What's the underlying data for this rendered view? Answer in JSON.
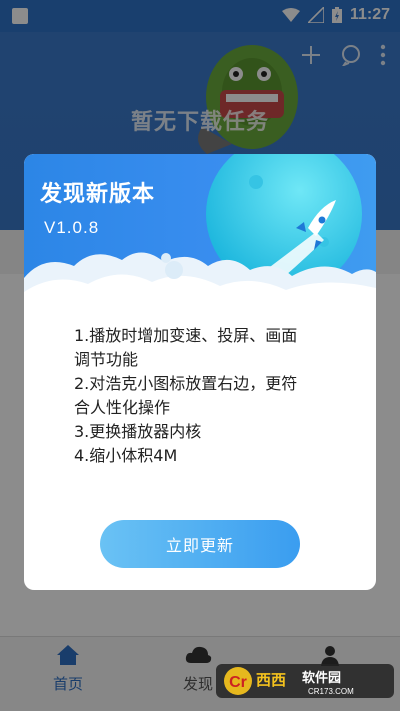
{
  "status_bar": {
    "time": "11:27"
  },
  "header": {
    "empty_text": "暂无下载任务"
  },
  "bottom_nav": {
    "items": [
      {
        "label": "首页"
      },
      {
        "label": "发现"
      }
    ]
  },
  "dialog": {
    "title": "发现新版本",
    "version": "V1.0.8",
    "notes": [
      "1.播放时增加变速、投屏、画面",
      "调节功能",
      "2.对浩克小图标放置右边，更符",
      "合人性化操作",
      "3.更换播放器内核",
      "4.缩小体积4M"
    ],
    "update_button": "立即更新"
  },
  "watermark": {
    "brand": "西西软件园",
    "site": "CR173.COM"
  },
  "colors": {
    "primary": "#2f73c8",
    "dialog_blue": "#2c86e6",
    "button_start": "#6ac2f4",
    "button_end": "#3a9df0"
  }
}
